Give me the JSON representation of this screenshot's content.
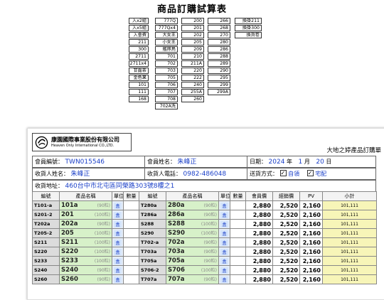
{
  "page_title": "商品訂購試算表",
  "code_columns": [
    [
      "入x2組",
      "入x5組",
      "入會費",
      "211",
      "300",
      "2711",
      "2711x4",
      "甘露茶",
      "金色果",
      "101",
      "111",
      "168"
    ],
    [
      "777Q",
      "777Qx4",
      "大女王",
      "小女王",
      "艦隊鳥",
      "701",
      "702",
      "703",
      "705",
      "706",
      "707",
      "708",
      "702A洗"
    ],
    [
      "200",
      "201",
      "202",
      "205",
      "209",
      "210",
      "211A",
      "220",
      "222",
      "240",
      "255A",
      "260"
    ],
    [
      "266",
      "268",
      "270",
      "280",
      "286",
      "288",
      "289",
      "290",
      "295",
      "299",
      "299A"
    ],
    [
      "換掛211",
      "換掛300",
      "換貨卷"
    ]
  ],
  "form": {
    "company_name": "康園國際事業股份有限公司",
    "company_en": "Heaven Only International CO.,LTD.",
    "tagline": "大地之婷產品訂購單",
    "member_no_label": "會員編號：",
    "member_no": "TWN015546",
    "member_name_label": "會員姓名：",
    "member_name": "朱峰正",
    "date_label": "日期：",
    "date_year": "2024",
    "date_year_unit": "年",
    "date_month": "1",
    "date_month_unit": "月",
    "date_day": "20",
    "date_day_unit": "日",
    "consignee_label": "收貨人姓名：",
    "consignee": "朱峰正",
    "phone_label": "收貨人電話：",
    "phone": "0982-486048",
    "delivery_label": "送貨方式：",
    "delivery_self": "自領",
    "delivery_home": "宅配",
    "address_label": "收貨地址：",
    "address": "460台中市北屯區同榮路303號8樓之1"
  },
  "table": {
    "headers": [
      "編號",
      "產品名稱",
      "單位",
      "數量",
      "編號",
      "產品名稱",
      "單位",
      "數量",
      "會員價",
      "經銷價",
      "PV",
      "小計"
    ],
    "unit_label": "盒",
    "rows": [
      {
        "c1": "T101-a",
        "n1": "101a",
        "v1": "(90粒)",
        "c2": "T280a",
        "n2": "280a",
        "v2": "(90粒)",
        "mp": "2,880",
        "dp": "2,520",
        "pv": "2,160",
        "sub": "101,111"
      },
      {
        "c1": "S201-2",
        "n1": "201",
        "v1": "(100粒)",
        "c2": "T286a",
        "n2": "286a",
        "v2": "(90粒)",
        "mp": "2,880",
        "dp": "2,520",
        "pv": "2,160",
        "sub": "101,111"
      },
      {
        "c1": "T202a",
        "n1": "202a",
        "v1": "(90粒)",
        "c2": "S288",
        "n2": "S288",
        "v2": "(100粒)",
        "mp": "2,880",
        "dp": "2,520",
        "pv": "2,160",
        "sub": "101,111"
      },
      {
        "c1": "T205-2",
        "n1": "205",
        "v1": "(100粒)",
        "c2": "S290",
        "n2": "S290",
        "v2": "(100粒)",
        "mp": "2,880",
        "dp": "2,520",
        "pv": "2,160",
        "sub": "101,111"
      },
      {
        "c1": "S211",
        "n1": "S211",
        "v1": "(100粒)",
        "c2": "T702-a",
        "n2": "702a",
        "v2": "(90粒)",
        "mp": "2,880",
        "dp": "2,520",
        "pv": "2,160",
        "sub": "101,111"
      },
      {
        "c1": "S220",
        "n1": "S220",
        "v1": "(100粒)",
        "c2": "T703a",
        "n2": "703a",
        "v2": "(90粒)",
        "mp": "2,880",
        "dp": "2,520",
        "pv": "2,160",
        "sub": "101,111"
      },
      {
        "c1": "S233",
        "n1": "S233",
        "v1": "(100粒)",
        "c2": "T705a",
        "n2": "705a",
        "v2": "(90粒)",
        "mp": "2,880",
        "dp": "2,520",
        "pv": "2,160",
        "sub": "101,111"
      },
      {
        "c1": "S240",
        "n1": "S240",
        "v1": "(90粒)",
        "c2": "S706-2",
        "n2": "S706",
        "v2": "(100粒)",
        "mp": "2,880",
        "dp": "2,520",
        "pv": "2,160",
        "sub": "101,111"
      },
      {
        "c1": "S260",
        "n1": "S260",
        "v1": "(90粒)",
        "c2": "T707a",
        "n2": "707a",
        "v2": "(90粒)",
        "mp": "2,880",
        "dp": "2,520",
        "pv": "2,160",
        "sub": "101,111"
      }
    ]
  }
}
